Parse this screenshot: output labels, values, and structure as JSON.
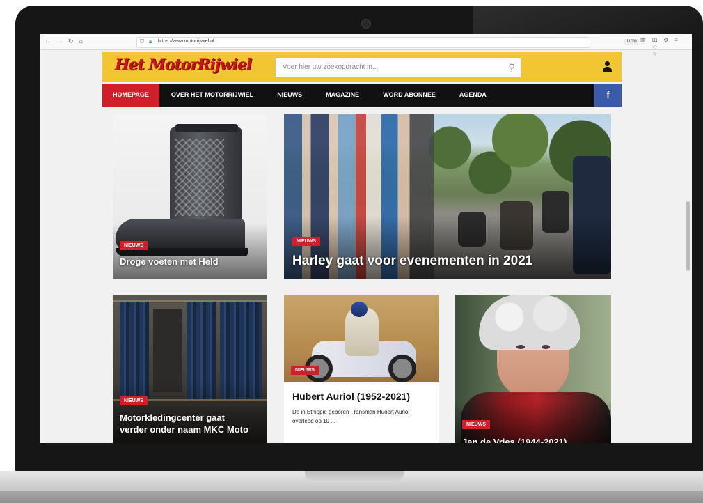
{
  "browser": {
    "url": "https://www.motorrijwiel.nl",
    "zoom": "110%",
    "nav_icons": [
      "←",
      "→",
      "↻",
      "⌂"
    ],
    "url_actions": "··· ♡ ☆",
    "tool_icons": [
      "▥",
      "◫",
      "⚙",
      "≡"
    ]
  },
  "site": {
    "logo": "Het MotorRijwiel",
    "search_placeholder": "Voer hier uw zoekopdracht in...",
    "nav": [
      "HOMEPAGE",
      "OVER HET MOTORRIJWIEL",
      "NIEUWS",
      "MAGAZINE",
      "WORD ABONNEE",
      "AGENDA"
    ],
    "facebook_label": "f"
  },
  "articles": [
    {
      "badge": "NIEUWS",
      "title": "Droge voeten met Held"
    },
    {
      "badge": "NIEUWS",
      "title": "Harley gaat voor evenementen in 2021"
    },
    {
      "badge": "NIEUWS",
      "title": "Motorkledingcenter gaat verder onder naam MKC Moto"
    },
    {
      "badge": "NIEUWS",
      "title": "Hubert Auriol (1952-2021)",
      "excerpt": "De in Ethiopië geboren Fransman Huoert Auriol overleed op 10 ..."
    },
    {
      "badge": "NIEUWS",
      "title": "Jan de Vries (1944-2021)"
    }
  ],
  "colors": {
    "header_yellow": "#f2c533",
    "accent_red": "#d01e2a",
    "nav_black": "#111111",
    "facebook_blue": "#3b5ba8"
  },
  "icons": [
    "shield-icon",
    "lock-icon",
    "search-icon",
    "user-icon",
    "facebook-icon"
  ]
}
